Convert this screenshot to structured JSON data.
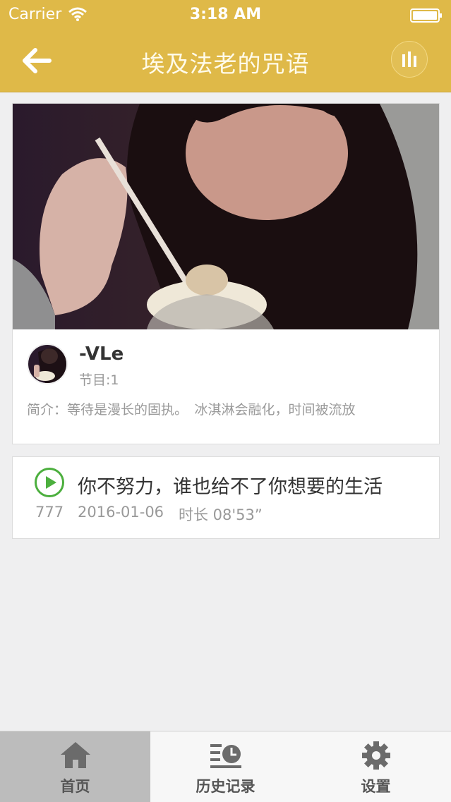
{
  "status_bar": {
    "carrier": "Carrier",
    "time": "3:18 AM"
  },
  "header": {
    "title": "埃及法老的咒语"
  },
  "album": {
    "author": "-VLe",
    "episode_count": "节目:1",
    "intro": "简介：等待是漫长的固执。　冰淇淋会融化，时间被流放"
  },
  "episode": {
    "title": "你不努力，谁也给不了你想要的生活",
    "play_count": "777",
    "date": "2016-01-06",
    "duration": "时长 08'53”"
  },
  "tabs": [
    {
      "label": "首页",
      "icon": "home-icon",
      "active": true
    },
    {
      "label": "历史记录",
      "icon": "history-icon",
      "active": false
    },
    {
      "label": "设置",
      "icon": "gear-icon",
      "active": false
    }
  ],
  "colors": {
    "header": "#dfb948",
    "play_green": "#4caf3e"
  }
}
